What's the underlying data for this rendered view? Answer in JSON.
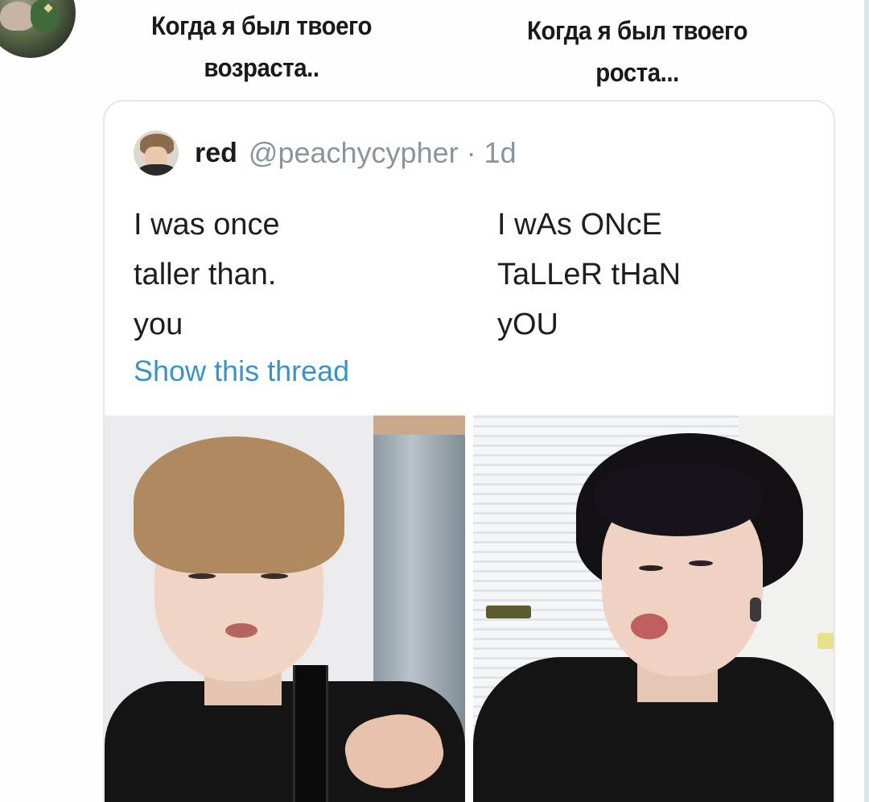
{
  "meme": {
    "caption_left": [
      "Когда я был твоего",
      "возраста.."
    ],
    "caption_right": [
      "Когда я был твоего",
      "роста..."
    ]
  },
  "tweet": {
    "author_name": "red",
    "author_handle": "@peachycypher",
    "separator": "·",
    "time_ago": "1d",
    "text_left": [
      "I was once",
      "taller than.",
      "you"
    ],
    "text_right": [
      "I wAs ONcE",
      "TaLLeR tHaN",
      "yOU"
    ],
    "show_thread_label": "Show this thread"
  },
  "colors": {
    "link": "#3a93c8",
    "meta_gray": "#8a949c",
    "card_border": "#e3e8ec"
  },
  "icons": {
    "top_avatar": "cropped-profile-avatar",
    "tweet_avatar": "user-avatar"
  }
}
